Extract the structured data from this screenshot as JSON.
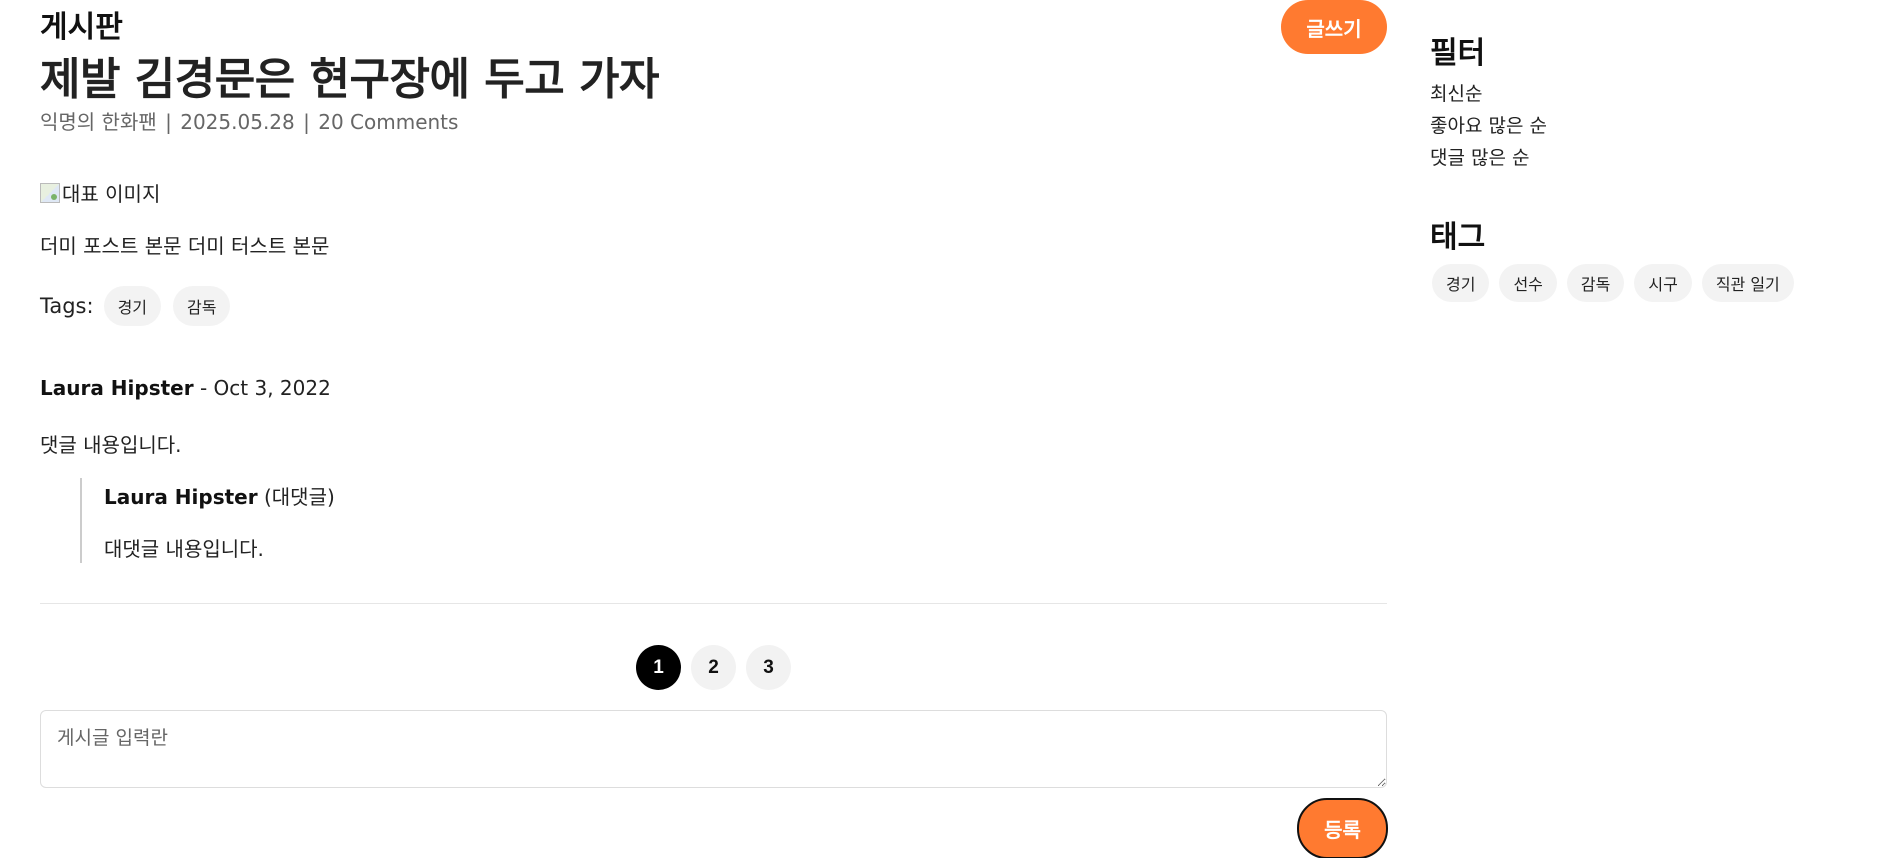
{
  "header": {
    "board_title": "게시판",
    "write_button": "글쓰기"
  },
  "post": {
    "title": "제발 김경문은 현구장에 두고 가자",
    "author": "익명의 한화팬",
    "date": "2025.05.28",
    "comments_count": "20 Comments",
    "separator": "|",
    "image_alt": "대표 이미지",
    "body": "더미 포스트 본문 더미 터스트 본문",
    "tags_label": "Tags:",
    "tags": [
      "경기",
      "감독"
    ]
  },
  "comment": {
    "author": "Laura Hipster",
    "date_suffix": " - Oct 3, 2022",
    "body": "댓글 내용입니다.",
    "reply": {
      "author": "Laura Hipster",
      "label": " (대댓글)",
      "body": "대댓글 내용입니다."
    }
  },
  "pagination": {
    "pages": [
      "1",
      "2",
      "3"
    ],
    "active_page": "1"
  },
  "composer": {
    "placeholder": "게시글 입력란",
    "value": "",
    "submit_label": "등록"
  },
  "sidebar": {
    "filter_heading": "필터",
    "filters": [
      "최신순",
      "좋아요 많은 순",
      "댓글 많은 순"
    ],
    "tag_heading": "태그",
    "tags": [
      "경기",
      "선수",
      "감독",
      "시구",
      "직관 일기"
    ]
  },
  "colors": {
    "accent": "#ff7a30",
    "page_active": "#000000",
    "tag_bg": "#f3f3f3"
  },
  "icons": {
    "broken_image": "broken-image-icon"
  }
}
